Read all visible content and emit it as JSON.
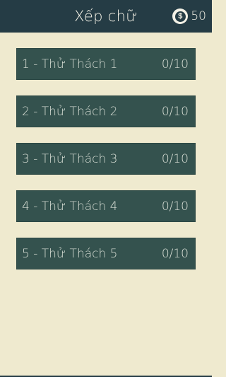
{
  "header": {
    "title": "Xếp chữ",
    "coin_icon": "coin-icon",
    "coin_symbol": "$",
    "coin_count": "50"
  },
  "levels": [
    {
      "label": "1 - Thử Thách 1",
      "progress": "0/10"
    },
    {
      "label": "2 - Thử Thách 2",
      "progress": "0/10"
    },
    {
      "label": "3 - Thử Thách 3",
      "progress": "0/10"
    },
    {
      "label": "4 - Thử Thách 4",
      "progress": "0/10"
    },
    {
      "label": "5 - Thử Thách 5",
      "progress": "0/10"
    }
  ],
  "colors": {
    "header_bg": "#253c45",
    "page_bg": "#efeacf",
    "item_bg": "#34524e",
    "item_text": "#d9dfd6"
  }
}
